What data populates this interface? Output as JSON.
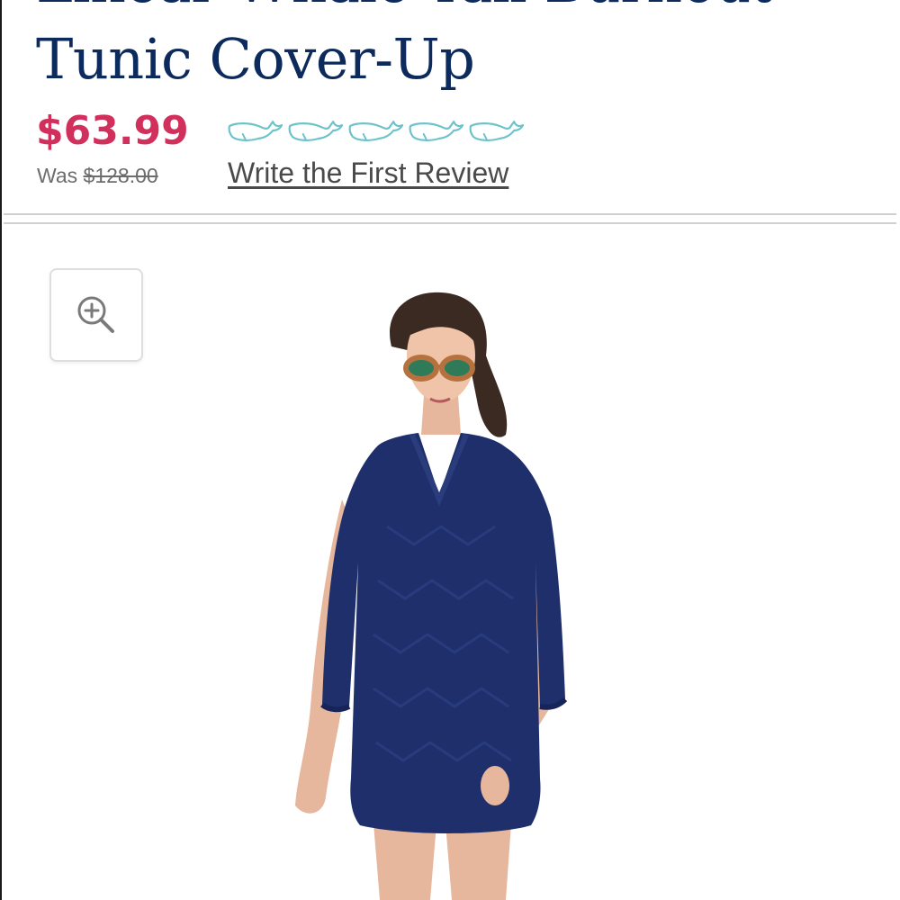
{
  "product": {
    "title_line1": "Linear Whale Tail Burnout",
    "title_line2": "Tunic Cover-Up"
  },
  "pricing": {
    "sale_price": "$63.99",
    "was_label": "Was",
    "original_price": "$128.00"
  },
  "rating": {
    "icon": "whale-icon",
    "count": 5,
    "value": 0,
    "review_link_label": "Write the First Review"
  },
  "gallery": {
    "zoom_icon": "zoom-in-icon"
  },
  "colors": {
    "title": "#0c2a5b",
    "sale_price": "#d2305c",
    "whale_outline": "#6cc3c9",
    "dress": "#1e2f6b"
  }
}
